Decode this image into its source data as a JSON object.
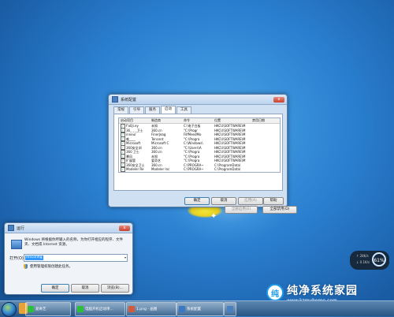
{
  "colors": {
    "desktop": "#2a7fd0",
    "window_frame": "#cfe0f2",
    "selection": "#3399ff",
    "watermark_accent": "#1e9be6"
  },
  "msconfig": {
    "title": "系统配置",
    "close": "x",
    "tabs": [
      "常规",
      "引导",
      "服务",
      "启动",
      "工具"
    ],
    "active_tab": "启动",
    "columns": [
      "启动项目",
      "制造商",
      "命令",
      "位置",
      "禁用日期"
    ],
    "rows": [
      {
        "checked": true,
        "item": "f'a0ji.ey",
        "maker": "未知",
        "cmd": "C:\\电子白板",
        "loc": "HKCU\\SOFTWARE\\M",
        "date": ""
      },
      {
        "checked": true,
        "item": "36_ _ _卫士",
        "maker": "360.cn",
        "cmd": "\"C:\\Progr",
        "loc": "HKCU\\SOFTWARE\\M",
        "date": ""
      },
      {
        "checked": true,
        "item": "inneur",
        "maker": "FinerJeag",
        "cmd": "FilfMeedMo",
        "loc": "HKCU\\SOFTWARE\\M",
        "date": ""
      },
      {
        "checked": true,
        "item": "唯____",
        "maker": "Tencent",
        "cmd": "\"C:\\Progra",
        "loc": "HKCU\\SOFTWARE\\M",
        "date": ""
      },
      {
        "checked": true,
        "item": "Microsoft",
        "maker": "Microsoft C",
        "cmd": "C:\\Windows\\",
        "loc": "HKCU\\SOFTWARE\\M",
        "date": ""
      },
      {
        "checked": true,
        "item": "360安全浏",
        "maker": "360.cn",
        "cmd": "\"C:\\Users\\A",
        "loc": "HKCU\\SOFTWARE\\M",
        "date": ""
      },
      {
        "checked": true,
        "item": "360 卫士",
        "maker": "360.cn",
        "cmd": "\"C:\\Progra",
        "loc": "HKCU\\SOFTWARE\\M",
        "date": ""
      },
      {
        "checked": true,
        "item": "暴风",
        "maker": "未知",
        "cmd": "\"C:\\Progra",
        "loc": "HKCU\\SOFTWARE\\M",
        "date": ""
      },
      {
        "checked": true,
        "item": "扩展管",
        "maker": "爱奇艺",
        "cmd": "\"C:\\Progra",
        "loc": "HKCU\\SOFTWARE\\M",
        "date": ""
      },
      {
        "checked": true,
        "item": "360安全卫士",
        "maker": "360.cn",
        "cmd": "C:\\PROGRA~",
        "loc": "C:\\ProgramData\\",
        "date": ""
      },
      {
        "checked": true,
        "item": "Modeler Re",
        "maker": "Modeler Inc",
        "cmd": "C:\\PROGRA~",
        "loc": "C:\\ProgramData\\",
        "date": ""
      }
    ],
    "enable_all": "全部启用(E)",
    "disable_all": "全部禁用(D)",
    "ok": "确定",
    "cancel": "取消",
    "apply": "应用(A)",
    "help": "帮助"
  },
  "run": {
    "title": "运行",
    "close": "x",
    "description": "Windows 将根据你所输入的名称，为你打开相应的程序、文件夹、文档或 Internet 资源。",
    "open_label": "打开(O):",
    "open_value": "msconfig",
    "uac_note": "使用管理权限创建此任务。",
    "ok": "确定",
    "cancel": "取消",
    "browse": "浏览(B)..."
  },
  "gadget": {
    "line1": "↑ 28K/s",
    "line2": "↓ 0.1K/s",
    "percent": "61%"
  },
  "taskbar": {
    "items": [
      {
        "label": "爱奇艺",
        "color": "#2bbf3c"
      },
      {
        "label": "电脑开机启动项...",
        "color": "#2bbf3c"
      },
      {
        "label": "1.png - 画图",
        "color": "#d35a3a"
      },
      {
        "label": "系统配置",
        "color": "#3a78c2"
      }
    ]
  },
  "watermark": {
    "logo": "纯",
    "title": "纯净系统家园",
    "url": "www.kzmyhome.com"
  }
}
